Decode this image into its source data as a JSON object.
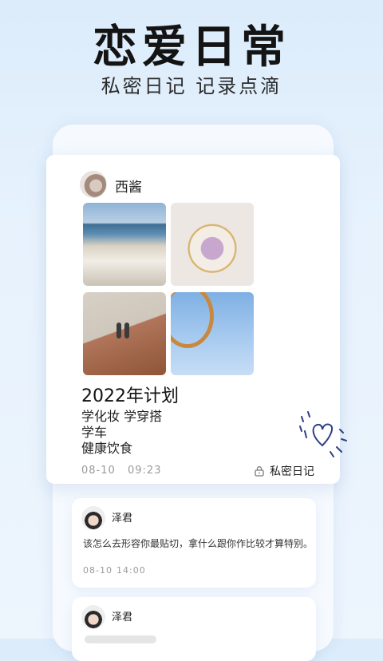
{
  "header": {
    "title": "恋爱日常",
    "subtitle": "私密日记 记录点滴"
  },
  "diary_card": {
    "username": "西酱",
    "entry_title": "2022年计划",
    "entry_lines": [
      "学化妆 学穿搭",
      "学车",
      "健康饮食"
    ],
    "date": "08-10",
    "time": "09:23",
    "privacy_label": "私密日记",
    "photos": [
      "city-harbor-photo",
      "flower-plate-photo",
      "couple-hill-photo",
      "swing-ride-photo"
    ]
  },
  "comments": [
    {
      "name": "泽君",
      "text": "该怎么去形容你最贴切，拿什么跟你作比较才算特别。",
      "date": "08-10",
      "time": "14:00"
    },
    {
      "name": "泽君"
    }
  ],
  "colors": {
    "background": "#dcecfb",
    "card": "#ffffff",
    "doodle": "#2f3f86"
  }
}
